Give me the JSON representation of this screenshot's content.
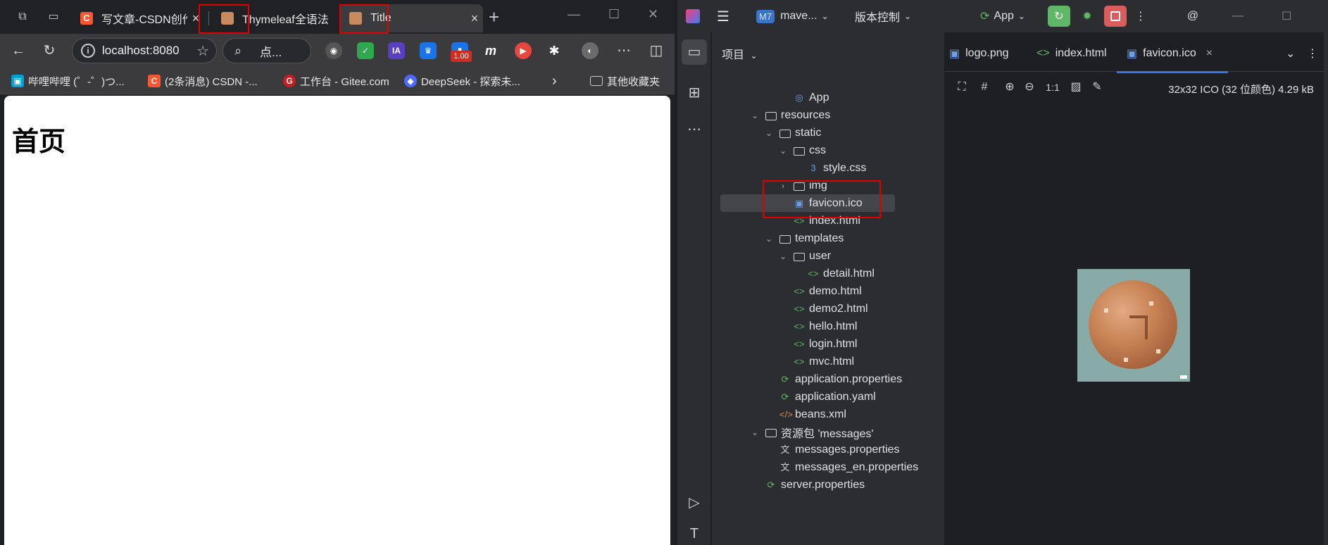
{
  "browser": {
    "tabs": [
      {
        "title": "写文章-CSDN创作中心",
        "favicon_color": "#fc5531"
      },
      {
        "title": "Thymeleaf全语法",
        "favicon_color": "#c98a5e"
      },
      {
        "title": "Title",
        "favicon_color": "#c98a5e"
      }
    ],
    "address": "localhost:8080",
    "search_label": "点...",
    "extensions_badge": "1.00",
    "bookmarks": [
      {
        "label": "哔哩哔哩 (゜-゜)つ...",
        "icon": "bilibili-icon",
        "color": "#00a1d6"
      },
      {
        "label": "(2条消息) CSDN -...",
        "icon": "csdn-icon",
        "color": "#fc5531"
      },
      {
        "label": "工作台 - Gitee.com",
        "icon": "gitee-icon",
        "color": "#c71d23"
      },
      {
        "label": "DeepSeek - 探索未...",
        "icon": "deepseek-icon",
        "color": "#4d6bfe"
      }
    ],
    "other_bookmarks": "其他收藏夹",
    "page_heading": "首页"
  },
  "ide": {
    "project_badge": "M7",
    "project_name": "mave...",
    "vcs": "版本控制",
    "run_config": "App",
    "panel_title": "项目",
    "tree": [
      {
        "label": "App",
        "depth": 3,
        "icon": "app-class-icon",
        "chev": ""
      },
      {
        "label": "resources",
        "depth": 1,
        "icon": "folder-resources-icon",
        "chev": "v"
      },
      {
        "label": "static",
        "depth": 2,
        "icon": "folder-icon",
        "chev": "v"
      },
      {
        "label": "css",
        "depth": 3,
        "icon": "folder-icon",
        "chev": "v"
      },
      {
        "label": "style.css",
        "depth": 4,
        "icon": "css-file-icon",
        "chev": ""
      },
      {
        "label": "img",
        "depth": 3,
        "icon": "folder-icon",
        "chev": ">"
      },
      {
        "label": "favicon.ico",
        "depth": 3,
        "icon": "image-file-icon",
        "chev": "",
        "selected": true
      },
      {
        "label": "index.html",
        "depth": 3,
        "icon": "html-file-icon",
        "chev": ""
      },
      {
        "label": "templates",
        "depth": 2,
        "icon": "folder-icon",
        "chev": "v"
      },
      {
        "label": "user",
        "depth": 3,
        "icon": "folder-icon",
        "chev": "v"
      },
      {
        "label": "detail.html",
        "depth": 4,
        "icon": "html-file-icon",
        "chev": ""
      },
      {
        "label": "demo.html",
        "depth": 3,
        "icon": "html-file-icon",
        "chev": ""
      },
      {
        "label": "demo2.html",
        "depth": 3,
        "icon": "html-file-icon",
        "chev": ""
      },
      {
        "label": "hello.html",
        "depth": 3,
        "icon": "html-file-icon",
        "chev": ""
      },
      {
        "label": "login.html",
        "depth": 3,
        "icon": "html-file-icon",
        "chev": ""
      },
      {
        "label": "mvc.html",
        "depth": 3,
        "icon": "html-file-icon",
        "chev": ""
      },
      {
        "label": "application.properties",
        "depth": 2,
        "icon": "spring-properties-icon",
        "chev": ""
      },
      {
        "label": "application.yaml",
        "depth": 2,
        "icon": "spring-yaml-icon",
        "chev": ""
      },
      {
        "label": "beans.xml",
        "depth": 2,
        "icon": "xml-file-icon",
        "chev": ""
      },
      {
        "label": "资源包 'messages'",
        "depth": 1,
        "icon": "resource-bundle-icon",
        "chev": "v"
      },
      {
        "label": "messages.properties",
        "depth": 2,
        "icon": "translate-file-icon",
        "chev": ""
      },
      {
        "label": "messages_en.properties",
        "depth": 2,
        "icon": "translate-file-icon",
        "chev": ""
      },
      {
        "label": "server.properties",
        "depth": 1,
        "icon": "spring-properties-icon",
        "chev": ""
      }
    ],
    "editor_tabs": [
      {
        "label": "logo.png",
        "icon": "image-file-icon"
      },
      {
        "label": "index.html",
        "icon": "html-file-icon"
      },
      {
        "label": "favicon.ico",
        "icon": "image-file-icon",
        "active": true
      }
    ],
    "zoom_label": "1:1",
    "image_info": "32x32 ICO (32 位颜色) 4.29 kB"
  },
  "colors": {
    "ide_accent": "#3574f0",
    "run_green": "#5fb865",
    "stop_red": "#db5c5c",
    "highlight_red": "#e00000"
  }
}
